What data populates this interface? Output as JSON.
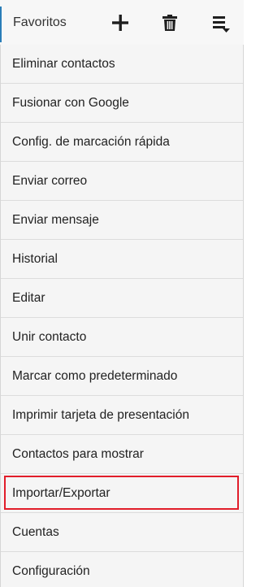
{
  "toolbar": {
    "tab_label": "Favoritos",
    "icons": [
      "add-icon",
      "delete-icon",
      "overflow-menu-icon"
    ]
  },
  "menu": {
    "items": [
      "Eliminar contactos",
      "Fusionar con Google",
      "Config. de marcación rápida",
      "Enviar correo",
      "Enviar mensaje",
      "Historial",
      "Editar",
      "Unir contacto",
      "Marcar como predeterminado",
      "Imprimir tarjeta de presentación",
      "Contactos para mostrar",
      "Importar/Exportar",
      "Cuentas",
      "Configuración"
    ],
    "highlighted_item": "Importar/Exportar"
  },
  "colors": {
    "highlight_border": "#e11d2a",
    "tab_indicator": "#2a7db8"
  }
}
